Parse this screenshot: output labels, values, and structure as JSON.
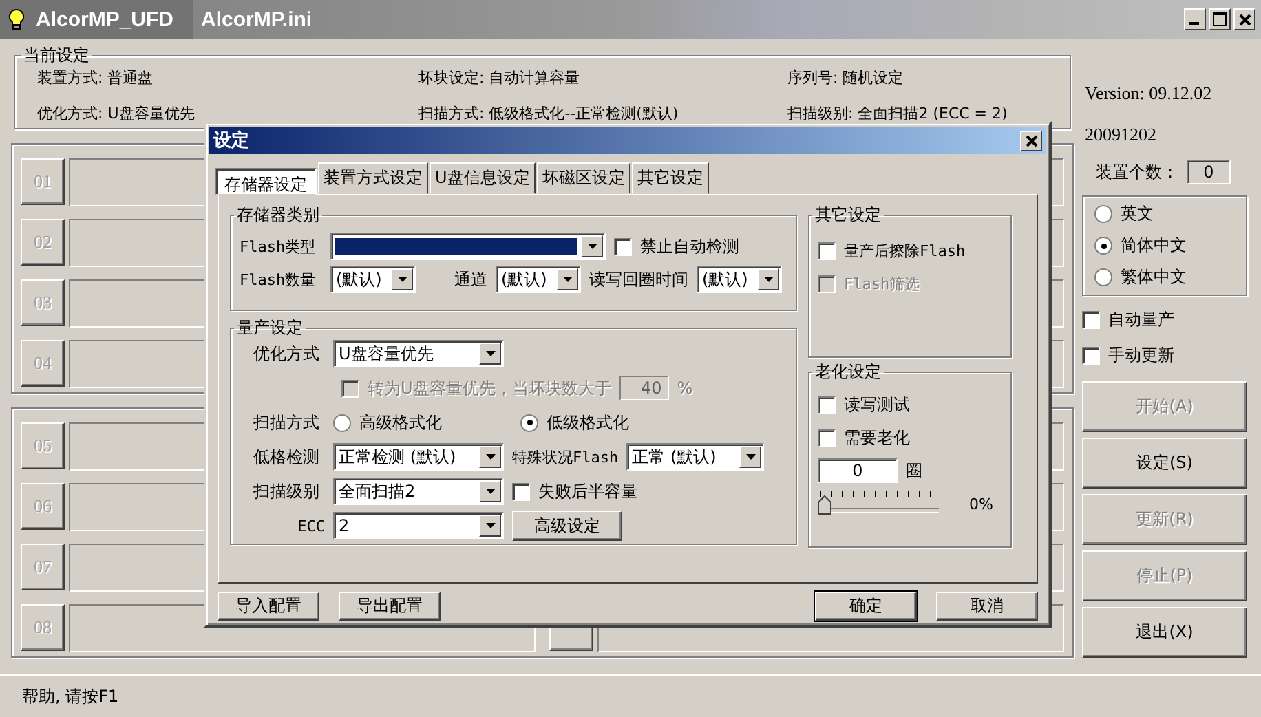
{
  "window": {
    "title": "AlcorMP_UFD",
    "file_tab": "AlcorMP.ini"
  },
  "current_settings": {
    "title": "当前设定",
    "items": [
      "装置方式: 普通盘",
      "坏块设定: 自动计算容量",
      "序列号: 随机设定",
      "优化方式: U盘容量优先",
      "扫描方式: 低级格式化--正常检测(默认)",
      "扫描级别: 全面扫描2 (ECC = 2)"
    ]
  },
  "slot_groups": [
    {
      "slots": [
        "01",
        "02",
        "03",
        "04"
      ]
    },
    {
      "slots": [
        "05",
        "06",
        "07",
        "08"
      ]
    }
  ],
  "version": "Version: 09.12.02",
  "build_date": "20091202",
  "device_count": {
    "label": "装置个数：",
    "value": "0"
  },
  "languages": [
    {
      "label": "英文",
      "selected": false
    },
    {
      "label": "简体中文",
      "selected": true
    },
    {
      "label": "繁体中文",
      "selected": false
    }
  ],
  "options": [
    {
      "label": "自动量产",
      "checked": false
    },
    {
      "label": "手动更新",
      "checked": false
    }
  ],
  "actions": [
    {
      "label": "开始(A)",
      "disabled": true
    },
    {
      "label": "设定(S)",
      "disabled": false
    },
    {
      "label": "更新(R)",
      "disabled": true
    },
    {
      "label": "停止(P)",
      "disabled": true
    },
    {
      "label": "退出(X)",
      "disabled": false
    }
  ],
  "status_bar": "帮助, 请按F1",
  "dialog": {
    "title": "设定",
    "tabs": [
      {
        "label": "存储器设定",
        "selected": true
      },
      {
        "label": "装置方式设定",
        "selected": false
      },
      {
        "label": "U盘信息设定",
        "selected": false
      },
      {
        "label": "坏磁区设定",
        "selected": false
      },
      {
        "label": "其它设定",
        "selected": false
      }
    ],
    "memory_type": {
      "title": "存储器类别",
      "flash_type": {
        "label": "Flash类型",
        "focused": true
      },
      "disable_auto_detect": {
        "label": "禁止自动检测",
        "checked": false
      },
      "flash_count": {
        "label": "Flash数量",
        "value": "(默认)"
      },
      "channel": {
        "label": "通道",
        "value": "(默认)"
      },
      "rw_loop_time": {
        "label": "读写回圈时间",
        "value": "(默认)"
      }
    },
    "production": {
      "title": "量产设定",
      "optimize": {
        "label": "优化方式",
        "value": "U盘容量优先"
      },
      "switch_option": {
        "label": "转为U盘容量优先，当坏块数大于",
        "value": "40",
        "unit": "%",
        "checked": false,
        "disabled": true
      },
      "scan_mode": {
        "label": "扫描方式",
        "options": [
          {
            "label": "高级格式化",
            "selected": false
          },
          {
            "label": "低级格式化",
            "selected": true
          }
        ]
      },
      "low_format_check": {
        "label": "低格检测",
        "value": "正常检测 (默认)"
      },
      "special_flash": {
        "label": "特殊状况Flash",
        "value": "正常 (默认)"
      },
      "scan_level": {
        "label": "扫描级别",
        "value": "全面扫描2"
      },
      "half_capacity": {
        "label": "失败后半容量",
        "checked": false
      },
      "ecc": {
        "label": "ECC",
        "value": "2"
      },
      "advanced_button": "高级设定"
    },
    "other": {
      "title": "其它设定",
      "options": [
        {
          "label": "量产后擦除Flash",
          "checked": false,
          "disabled": false
        },
        {
          "label": "Flash筛选",
          "checked": false,
          "disabled": true
        }
      ]
    },
    "aging": {
      "title": "老化设定",
      "options": [
        {
          "label": "读写测试",
          "checked": false
        },
        {
          "label": "需要老化",
          "checked": false
        }
      ],
      "rounds": {
        "value": "0",
        "unit": "圈"
      },
      "progress": {
        "level": 0,
        "reading": "0%"
      }
    },
    "buttons": {
      "import": "导入配置",
      "export": "导出配置",
      "ok": "确定",
      "cancel": "取消"
    }
  }
}
